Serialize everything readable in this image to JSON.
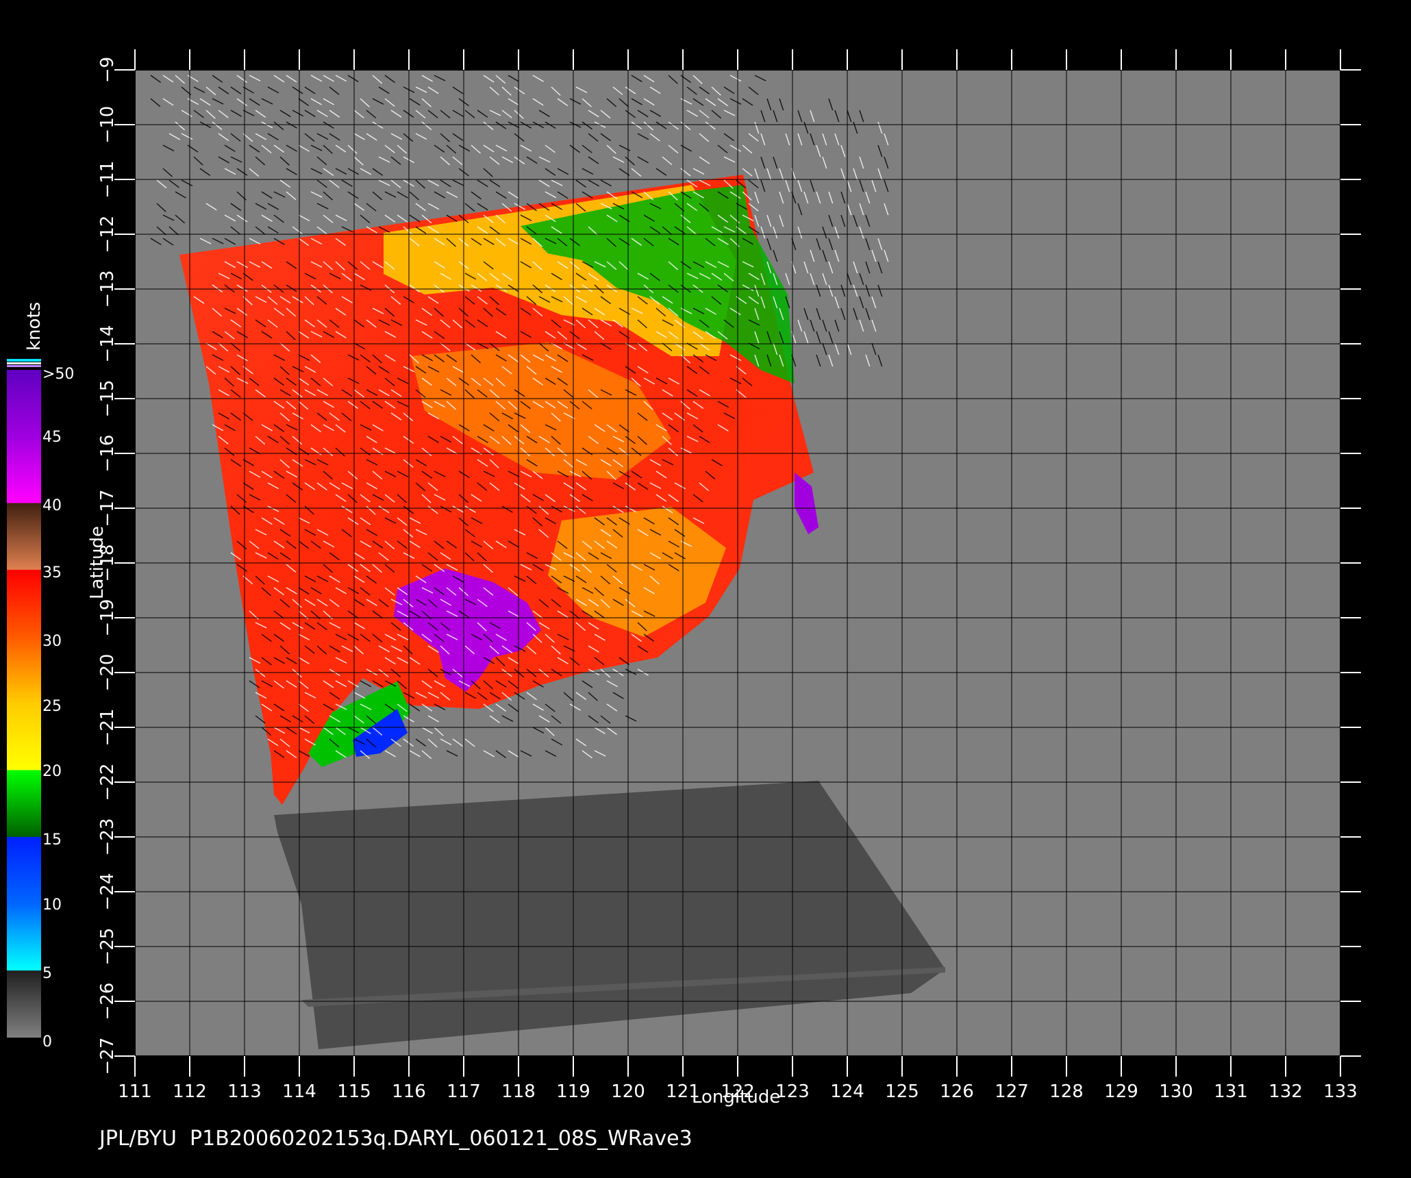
{
  "map": {
    "x_axis_title": "Longitude",
    "y_axis_title": "Latitude",
    "lon_ticks": [
      "111",
      "112",
      "113",
      "114",
      "115",
      "116",
      "117",
      "118",
      "119",
      "120",
      "121",
      "122",
      "123",
      "124",
      "125",
      "126",
      "127",
      "128",
      "129",
      "130",
      "131",
      "132",
      "133"
    ],
    "lat_ticks": [
      "−9",
      "−10",
      "−11",
      "−12",
      "−13",
      "−14",
      "−15",
      "−16",
      "−17",
      "−18",
      "−19",
      "−20",
      "−21",
      "−22",
      "−23",
      "−24",
      "−25",
      "−26",
      "−27"
    ],
    "lon_range": [
      111,
      133
    ],
    "lat_range": [
      -9,
      -27
    ],
    "background_color": "#7f7f7f",
    "land_color": "#4c4c4c",
    "grid": true
  },
  "colorbar": {
    "title": "knots",
    "labels": [
      ">50",
      "45",
      "40",
      "35",
      "30",
      "25",
      "20",
      "15",
      "10",
      "5",
      "0"
    ],
    "bands": [
      {
        "from": 0,
        "to": 5,
        "color": "#555555"
      },
      {
        "from": 5,
        "to": 10,
        "color": "#0090ff"
      },
      {
        "from": 10,
        "to": 15,
        "color": "#0030ff"
      },
      {
        "from": 15,
        "to": 20,
        "color": "#00b000"
      },
      {
        "from": 20,
        "to": 25,
        "color": "#ffdd00"
      },
      {
        "from": 25,
        "to": 30,
        "color": "#ff6a00"
      },
      {
        "from": 30,
        "to": 35,
        "color": "#ff1a00"
      },
      {
        "from": 35,
        "to": 40,
        "color": "#8a5030"
      },
      {
        "from": 40,
        "to": 45,
        "color": "#ff20ff"
      },
      {
        "from": 45,
        "to": 50,
        "color": "#7a10d0"
      }
    ]
  },
  "footer": {
    "caption": "JPL/BYU  P1B20060202153q.DARYL_060121_08S_WRave3"
  }
}
